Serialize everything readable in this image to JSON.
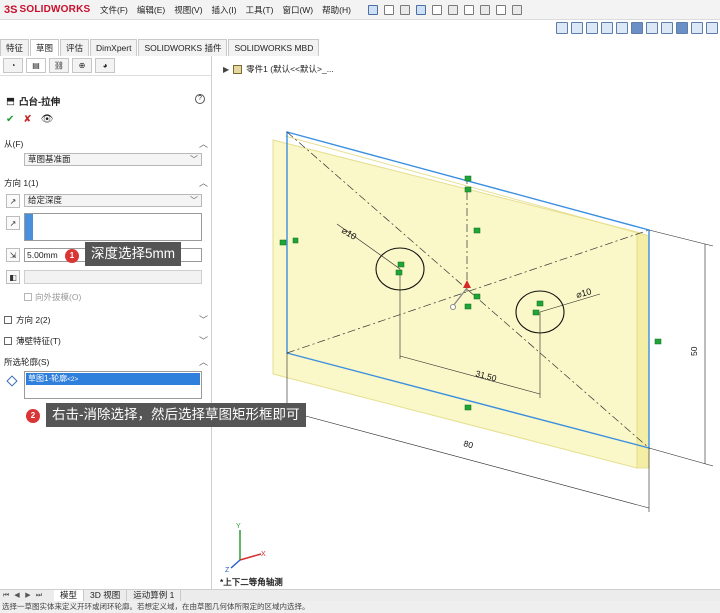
{
  "app": {
    "logo_ds": "3S",
    "logo_name": "SOLIDWORKS"
  },
  "menus": [
    "文件(F)",
    "编辑(E)",
    "视图(V)",
    "插入(I)",
    "工具(T)",
    "窗口(W)",
    "帮助(H)"
  ],
  "tabs": [
    {
      "label": "特征",
      "active": false
    },
    {
      "label": "草图",
      "active": true
    },
    {
      "label": "评估",
      "active": false
    },
    {
      "label": "DimXpert",
      "active": false
    },
    {
      "label": "SOLIDWORKS 插件",
      "active": false
    },
    {
      "label": "SOLIDWORKS MBD",
      "active": false
    }
  ],
  "property_manager": {
    "title": "凸台-拉伸",
    "help": "?",
    "ok": "✔",
    "cancel": "✘",
    "from": {
      "header": "从(F)",
      "value": "草图基准面"
    },
    "direction1": {
      "header": "方向 1(1)",
      "end_condition": "给定深度",
      "depth": "5.00mm",
      "draft_outward": "向外拔模(O)"
    },
    "direction2": {
      "header": "方向 2(2)"
    },
    "thin_feature": {
      "header": "薄壁特征(T)"
    },
    "selected_contours": {
      "header": "所选轮廓(S)",
      "item": "草图1-轮廓",
      "item_sub": "<2>"
    }
  },
  "callouts": [
    {
      "badge": "1",
      "text": "深度选择5mm"
    },
    {
      "badge": "2",
      "text": "右击-消除选择，然后选择草图矩形框即可"
    }
  ],
  "graphics": {
    "tree_label": "零件1  (默认<<默认>_...",
    "view_name": "*上下二等角轴测",
    "dims": {
      "d1": "⌀10",
      "d2": "⌀10",
      "width": "80",
      "height": "50",
      "offset": "31.50"
    }
  },
  "bottom_tabs": [
    {
      "label": "模型",
      "active": true
    },
    {
      "label": "3D 视图",
      "active": false
    },
    {
      "label": "运动算例 1",
      "active": false
    }
  ],
  "status_text": "选择一草图实体来定义开环或闭环轮廓。若想定义域，在由草图几何体所限定的区域内选择。",
  "colors": {
    "accent": "#2f7fdc",
    "extrude_fill": "#faf7c8",
    "sketch_edge": "#3a8fe0",
    "relation_green": "#21a436"
  }
}
